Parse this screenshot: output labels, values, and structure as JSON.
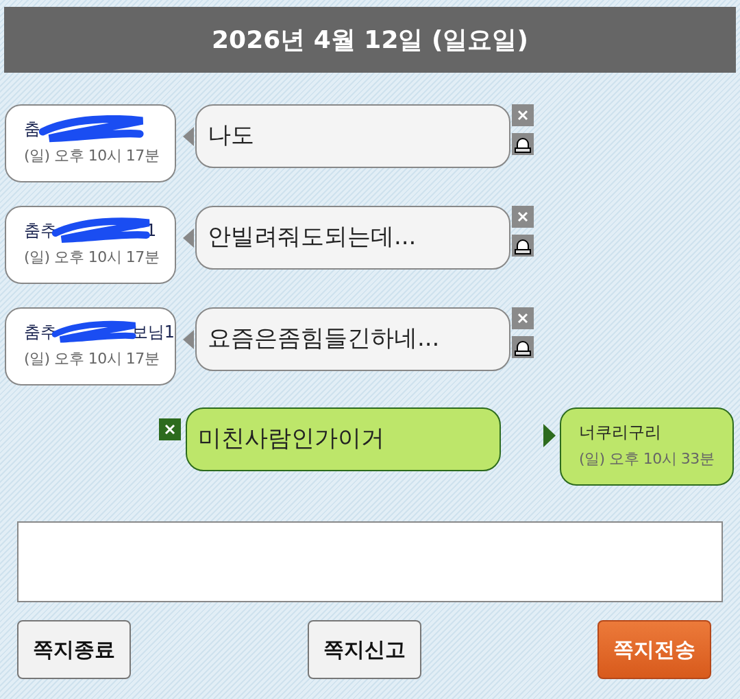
{
  "header": {
    "title": "2026년 4월 12일 (일요일)"
  },
  "messages": [
    {
      "kind": "received",
      "name_parts": [
        "춤"
      ],
      "time": "(일) 오후 10시 17분",
      "text": "나도"
    },
    {
      "kind": "received",
      "name_parts": [
        "춤추",
        "1"
      ],
      "time": "(일) 오후 10시 17분",
      "text": "안빌려줘도되는데..."
    },
    {
      "kind": "received",
      "name_parts": [
        "춤추",
        "보님1"
      ],
      "time": "(일) 오후 10시 17분",
      "text": "요즘은좀힘들긴하네..."
    },
    {
      "kind": "sent",
      "name_parts": [
        "너쿠리구리"
      ],
      "time": "(일) 오후 10시 33분",
      "text": "미친사람인가이거"
    }
  ],
  "buttons": [
    {
      "label": "쪽지종료",
      "kind": "plain"
    },
    {
      "label": "쪽지신고",
      "kind": "plain"
    },
    {
      "label": "쪽지전송",
      "kind": "primary"
    }
  ]
}
